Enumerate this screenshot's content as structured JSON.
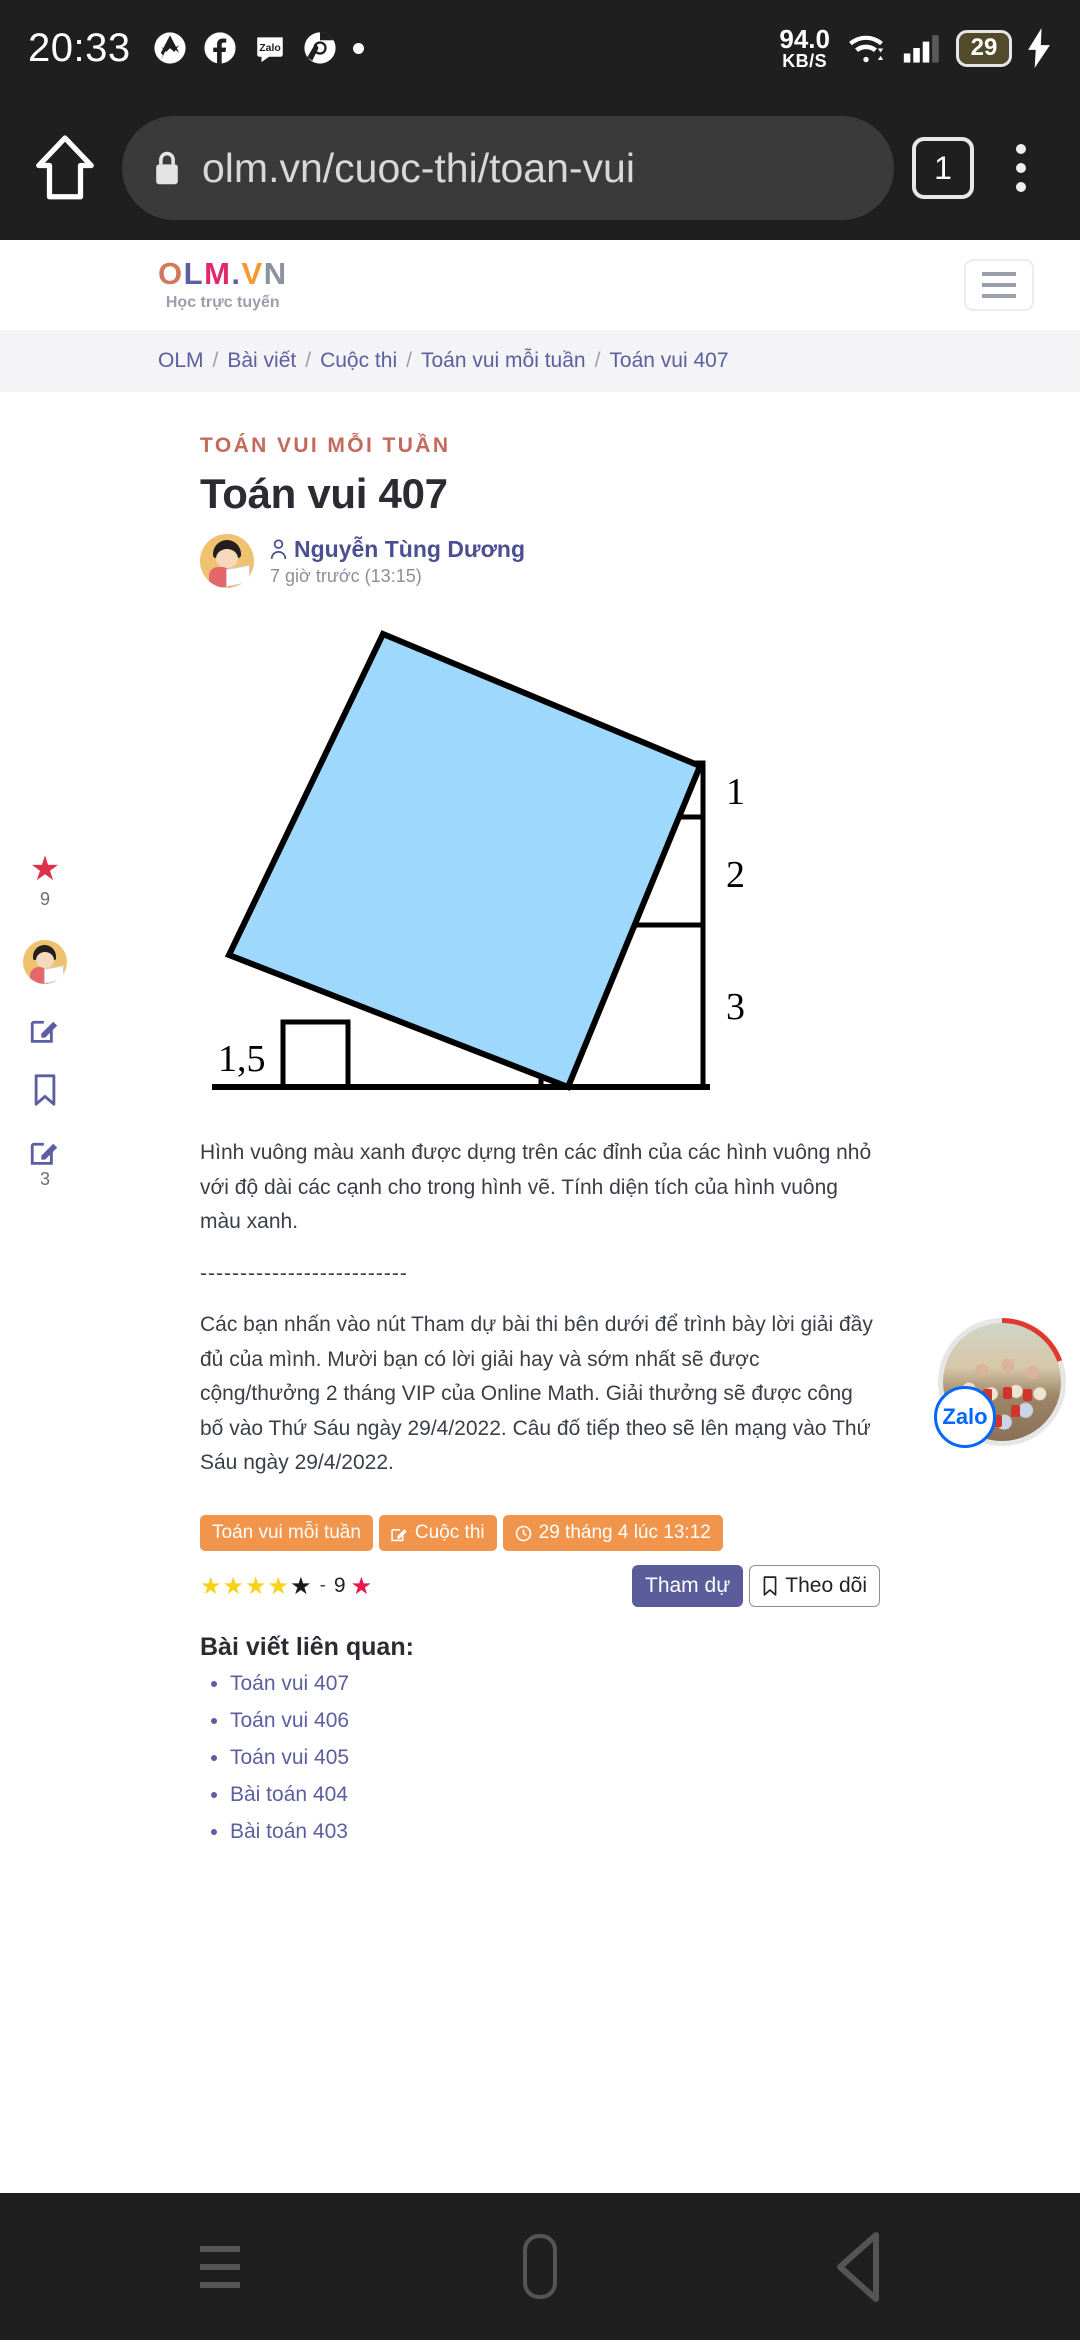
{
  "statusbar": {
    "clock": "20:33",
    "icons": [
      "messenger-icon",
      "facebook-icon",
      "zalo-icon",
      "chrome-icon",
      "dot-icon"
    ],
    "netspeed_value": "94.0",
    "netspeed_unit": "KB/S",
    "wifi": "wifi-icon",
    "signal": "cellular-signal-icon",
    "battery_percent": "29",
    "charging": "charging-bolt-icon"
  },
  "browser": {
    "home_icon": "home-icon",
    "lock_icon": "lock-icon",
    "url": "olm.vn/cuoc-thi/toan-vui",
    "tab_count": "1",
    "menu_icon": "kebab-menu-icon"
  },
  "site_header": {
    "logo_parts": [
      "O",
      "L",
      "M",
      ".",
      "V",
      "N"
    ],
    "logo_subtitle": "Học trực tuyến",
    "menu_icon": "hamburger-menu-icon"
  },
  "breadcrumb": {
    "items": [
      "OLM",
      "Bài viết",
      "Cuộc thi",
      "Toán vui mỗi tuần",
      "Toán vui 407"
    ],
    "separator": "/"
  },
  "article": {
    "kicker": "TOÁN VUI MỖI TUẦN",
    "title": "Toán vui 407",
    "author": "Nguyễn Tùng Dương",
    "author_icon": "user-icon",
    "timestamp": "7 giờ trước (13:15)",
    "paragraph_1": "Hình vuông màu xanh được dựng trên các đỉnh của các hình vuông nhỏ với độ dài các cạnh cho trong hình vẽ. Tính diện tích của hình vuông màu xanh.",
    "divider": "--------------------------",
    "paragraph_2": "Các bạn nhấn vào nút Tham dự bài thi bên dưới để trình bày lời giải đầy đủ của mình. Mười bạn có lời giải hay và sớm nhất sẽ được cộng/thưởng 2 tháng VIP của Online Math. Giải thưởng sẽ được công bố vào Thứ Sáu ngày 29/4/2022. Câu đố tiếp theo sẽ lên mạng vào Thứ Sáu ngày 29/4/2022."
  },
  "figure": {
    "alt": "geometry-diagram-tilted-blue-square-on-staircase-of-squares",
    "blue_fill": "#9fd8fd",
    "stroke": "#000000",
    "labels": [
      {
        "text": "1",
        "for": "square-top-right"
      },
      {
        "text": "2",
        "for": "square-middle-right"
      },
      {
        "text": "3",
        "for": "square-bottom-right"
      },
      {
        "text": "1,5",
        "for": "square-bottom-left"
      }
    ]
  },
  "tags": [
    {
      "label": "Toán vui mỗi tuần",
      "icon": null
    },
    {
      "label": "Cuộc thi",
      "icon": "edit-square-icon"
    },
    {
      "label": "29 tháng 4 lúc 13:12",
      "icon": "clock-icon"
    }
  ],
  "rating": {
    "filled_stars": 4,
    "empty_stars": 1,
    "separator": "-",
    "count": "9",
    "count_star_icon": "red-star-icon"
  },
  "actions": {
    "join_label": "Tham dự",
    "follow_label": "Theo dõi",
    "follow_icon": "bookmark-icon",
    "join_color": "#5a5d9a"
  },
  "related": {
    "heading": "Bài viết liên quan:",
    "items": [
      "Toán vui 407",
      "Toán vui 406",
      "Toán vui 405",
      "Bài toán 404",
      "Bài toán 403"
    ]
  },
  "rail": {
    "star_icon": "red-star-icon",
    "star_count": "9",
    "avatar": "user-avatar-icon",
    "edit_icon": "edit-square-icon",
    "bookmark_icon": "bookmark-icon",
    "comment_edit_icon": "edit-square-icon",
    "comment_count": "3"
  },
  "zalo": {
    "label": "Zalo",
    "brand_color": "#0068ff",
    "ring_color": "#e03a30"
  },
  "navbar": {
    "recents_icon": "recents-icon",
    "home_icon": "home-pill-icon",
    "back_icon": "back-triangle-icon"
  }
}
